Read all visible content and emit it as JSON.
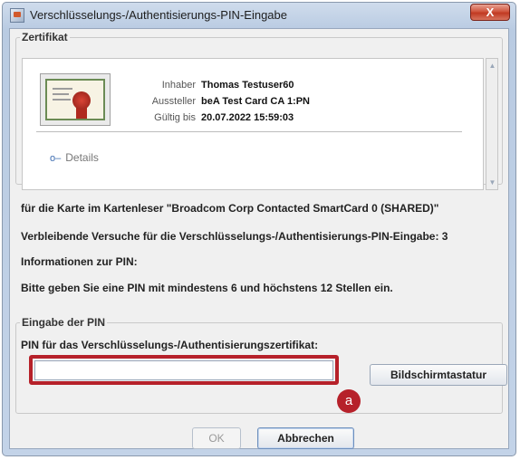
{
  "window": {
    "title": "Verschlüsselungs-/Authentisierungs-PIN-Eingabe",
    "close_label": "X"
  },
  "certificate": {
    "legend": "Zertifikat",
    "fields": [
      {
        "label": "Inhaber",
        "value": "Thomas Testuser60"
      },
      {
        "label": "Aussteller",
        "value": "beA Test Card CA 1:PN"
      },
      {
        "label": "Gültig bis",
        "value": "20.07.2022 15:59:03"
      }
    ],
    "details_label": "Details"
  },
  "info": {
    "card_reader": "für die Karte im Kartenleser \"Broadcom Corp Contacted SmartCard 0 (SHARED)\"",
    "remaining_attempts": "Verbleibende Versuche für die Verschlüsselungs-/Authentisierungs-PIN-Eingabe: 3",
    "pin_info_heading": "Informationen zur PIN:",
    "pin_rule": "Bitte geben Sie eine PIN mit mindestens 6 und höchstens 12 Stellen ein."
  },
  "pin_entry": {
    "legend": "Eingabe der PIN",
    "prompt": "PIN für das Verschlüsselungs-/Authentisierungszertifikat:",
    "value": "",
    "keyboard_button": "Bildschirmtastatur"
  },
  "annotation": {
    "badge": "a",
    "highlight_color": "#b6212a"
  },
  "buttons": {
    "ok": "OK",
    "cancel": "Abbrechen"
  }
}
